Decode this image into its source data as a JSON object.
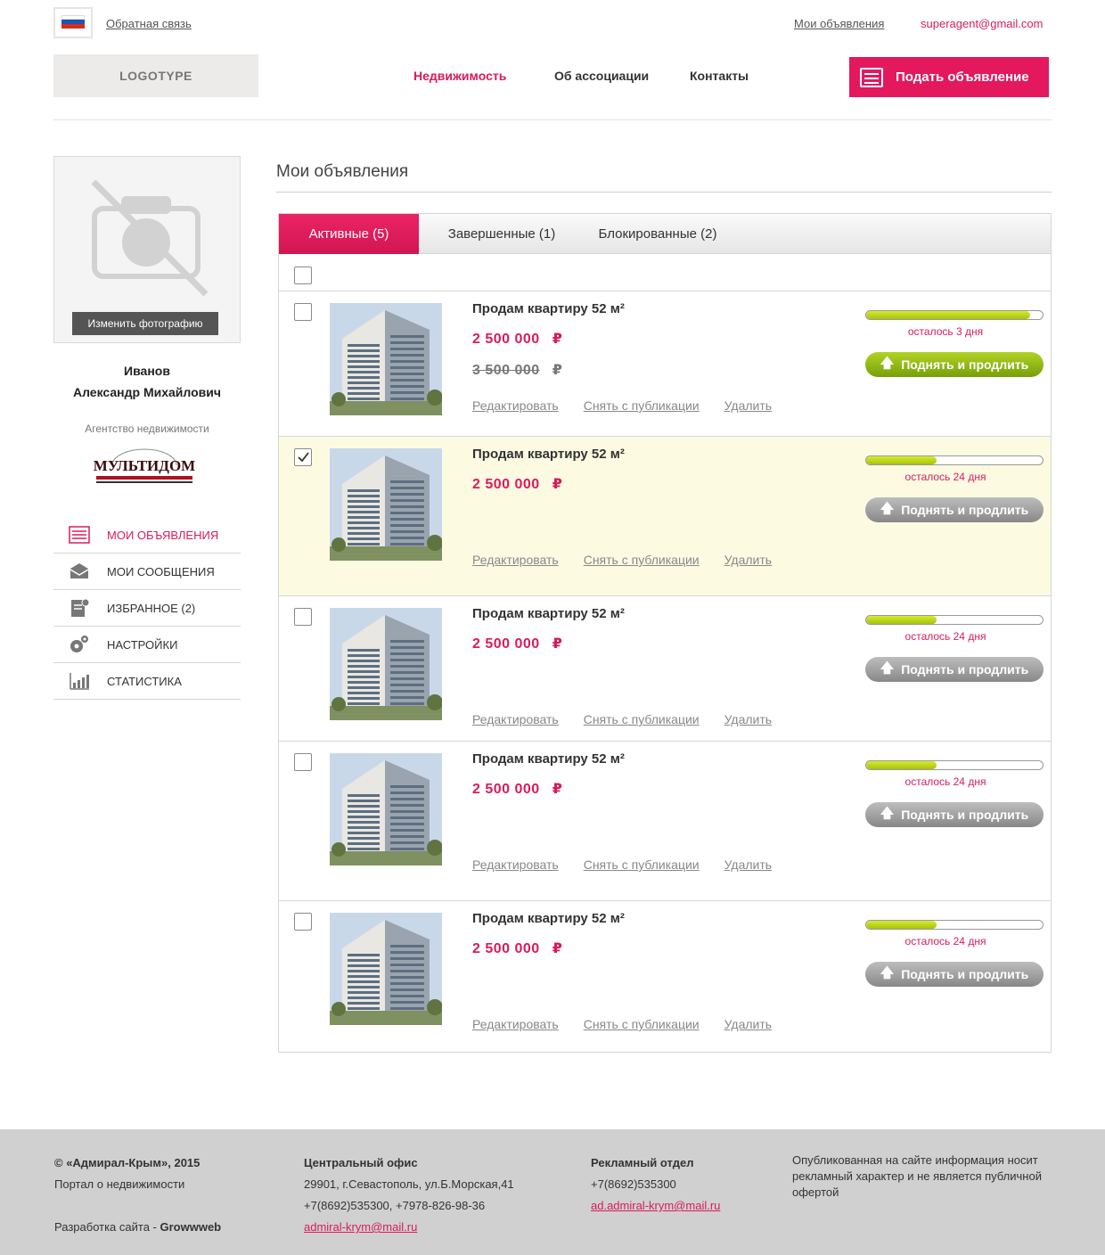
{
  "topbar": {
    "feedback_label": "Обратная связь",
    "my_ads_label": "Мои объявления",
    "email": "superagent@gmail.com"
  },
  "header": {
    "logo_text": "LOGOTYPE",
    "nav": [
      "Недвижимость",
      "Об ассоциации",
      "Контакты"
    ],
    "post_button": "Подать объявление"
  },
  "sidebar": {
    "change_photo": "Изменить фотографию",
    "last_name": "Иванов",
    "full_name": "Александр Михайлович",
    "agency_label": "Агентство недвижимости",
    "agency_logo_text": "МУЛЬТИДОМ",
    "menu": [
      {
        "label": "МОИ ОБЪЯВЛЕНИЯ",
        "icon": "listings-icon"
      },
      {
        "label": "МОИ СООБЩЕНИЯ",
        "icon": "messages-icon"
      },
      {
        "label": "ИЗБРАННОЕ (2)",
        "icon": "favorites-icon"
      },
      {
        "label": "НАСТРОЙКИ",
        "icon": "settings-icon"
      },
      {
        "label": "СТАТИСТИКА",
        "icon": "statistics-icon"
      }
    ]
  },
  "main": {
    "title": "Мои объявления",
    "tabs": [
      "Активные (5)",
      "Завершенные (1)",
      "Блокированные (2)"
    ],
    "actions": {
      "edit": "Редактировать",
      "unpublish": "Снять с публикации",
      "delete": "Удалить",
      "boost": "Поднять и продлить"
    },
    "currency": "₽",
    "listings": [
      {
        "title": "Продам квартиру 52 м²",
        "price": "2 500 000",
        "old_price": "3 500 000",
        "remaining": "осталось 3 дня",
        "progress": 0.93,
        "checked": false,
        "boost_style": "green"
      },
      {
        "title": "Продам квартиру 52 м²",
        "price": "2 500 000",
        "old_price": "",
        "remaining": "осталось 24 дня",
        "progress": 0.4,
        "checked": true,
        "boost_style": "gray"
      },
      {
        "title": "Продам квартиру 52 м²",
        "price": "2 500 000",
        "old_price": "",
        "remaining": "осталось 24 дня",
        "progress": 0.4,
        "checked": false,
        "boost_style": "gray"
      },
      {
        "title": "Продам квартиру 52 м²",
        "price": "2 500 000",
        "old_price": "",
        "remaining": "осталось 24 дня",
        "progress": 0.4,
        "checked": false,
        "boost_style": "gray"
      },
      {
        "title": "Продам квартиру 52 м²",
        "price": "2 500 000",
        "old_price": "",
        "remaining": "осталось 24 дня",
        "progress": 0.4,
        "checked": false,
        "boost_style": "gray"
      }
    ]
  },
  "footer": {
    "copyright": "© «Адмирал-Крым», 2015",
    "portal": "Портал о недвижимости",
    "dev_prefix": "Разработка сайта - ",
    "dev_name": "Growwweb",
    "office_title": "Центральный офис",
    "office_address": "29901, г.Севастополь, ул.Б.Морская,41",
    "office_phones": "+7(8692)535300, +7978-826-98-36",
    "office_email": "admiral-krym@mail.ru",
    "ads_title": "Рекламный отдел",
    "ads_phone": "+7(8692)535300",
    "ads_email": "ad.admiral-krym@mail.ru",
    "disclaimer": "Опубликованная на сайте информация носит рекламный характер и не является публичной офертой"
  },
  "colors": {
    "accent": "#e4185d",
    "progress_green": "#b1d326",
    "selected_row": "#fcfbe2",
    "footer_bg": "#d0d0d0"
  }
}
